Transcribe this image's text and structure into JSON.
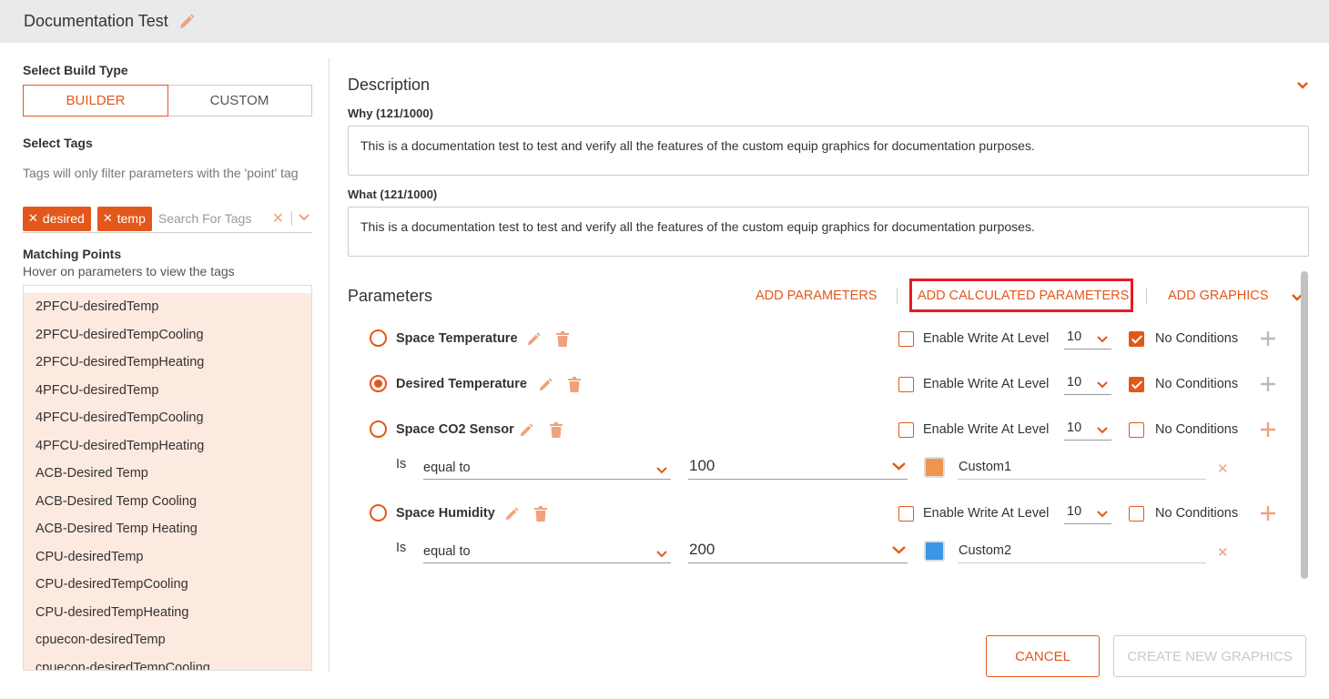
{
  "header": {
    "title": "Documentation Test"
  },
  "sidebar": {
    "build_type_label": "Select Build Type",
    "builder_label": "BUILDER",
    "custom_label": "CUSTOM",
    "tags_label": "Select Tags",
    "tags_hint": "Tags will only filter parameters with the 'point' tag",
    "tags": [
      "desired",
      "temp"
    ],
    "tag_search_placeholder": "Search For Tags",
    "matching_label": "Matching Points",
    "matching_hint": "Hover on parameters to view the tags",
    "points": [
      "2PFCU-desiredTemp",
      "2PFCU-desiredTempCooling",
      "2PFCU-desiredTempHeating",
      "4PFCU-desiredTemp",
      "4PFCU-desiredTempCooling",
      "4PFCU-desiredTempHeating",
      "ACB-Desired Temp",
      "ACB-Desired Temp Cooling",
      "ACB-Desired Temp Heating",
      "CPU-desiredTemp",
      "CPU-desiredTempCooling",
      "CPU-desiredTempHeating",
      "cpuecon-desiredTemp",
      "cpuecon-desiredTempCooling"
    ]
  },
  "description": {
    "title": "Description",
    "why_label": "Why (121/1000)",
    "why_value": "This is a documentation test to test and verify all the features of the custom equip graphics for documentation purposes.",
    "what_label": "What (121/1000)",
    "what_value": "This is a documentation test to test and verify all the features of the custom equip graphics for documentation purposes."
  },
  "parameters": {
    "title": "Parameters",
    "add_parameters": "ADD PARAMETERS",
    "add_calculated": "ADD CALCULATED PARAMETERS",
    "add_graphics": "ADD GRAPHICS",
    "enable_write_label": "Enable Write At Level",
    "no_conditions_label": "No Conditions",
    "is_label": "Is",
    "items": [
      {
        "name": "Space Temperature",
        "selected": false,
        "enable_write": false,
        "level": "10",
        "no_conditions": true
      },
      {
        "name": "Desired Temperature",
        "selected": true,
        "enable_write": false,
        "level": "10",
        "no_conditions": true
      },
      {
        "name": "Space CO2 Sensor",
        "selected": false,
        "enable_write": false,
        "level": "10",
        "no_conditions": false,
        "condition": {
          "operator": "equal to",
          "value": "100",
          "color": "#f0954f",
          "label": "Custom1"
        }
      },
      {
        "name": "Space Humidity",
        "selected": false,
        "enable_write": false,
        "level": "10",
        "no_conditions": false,
        "condition": {
          "operator": "equal to",
          "value": "200",
          "color": "#3d95ea",
          "label": "Custom2"
        }
      }
    ]
  },
  "footer": {
    "cancel": "CANCEL",
    "create": "CREATE NEW GRAPHICS"
  },
  "colors": {
    "accent": "#e2581b",
    "highlight_box": "#e41c23"
  }
}
